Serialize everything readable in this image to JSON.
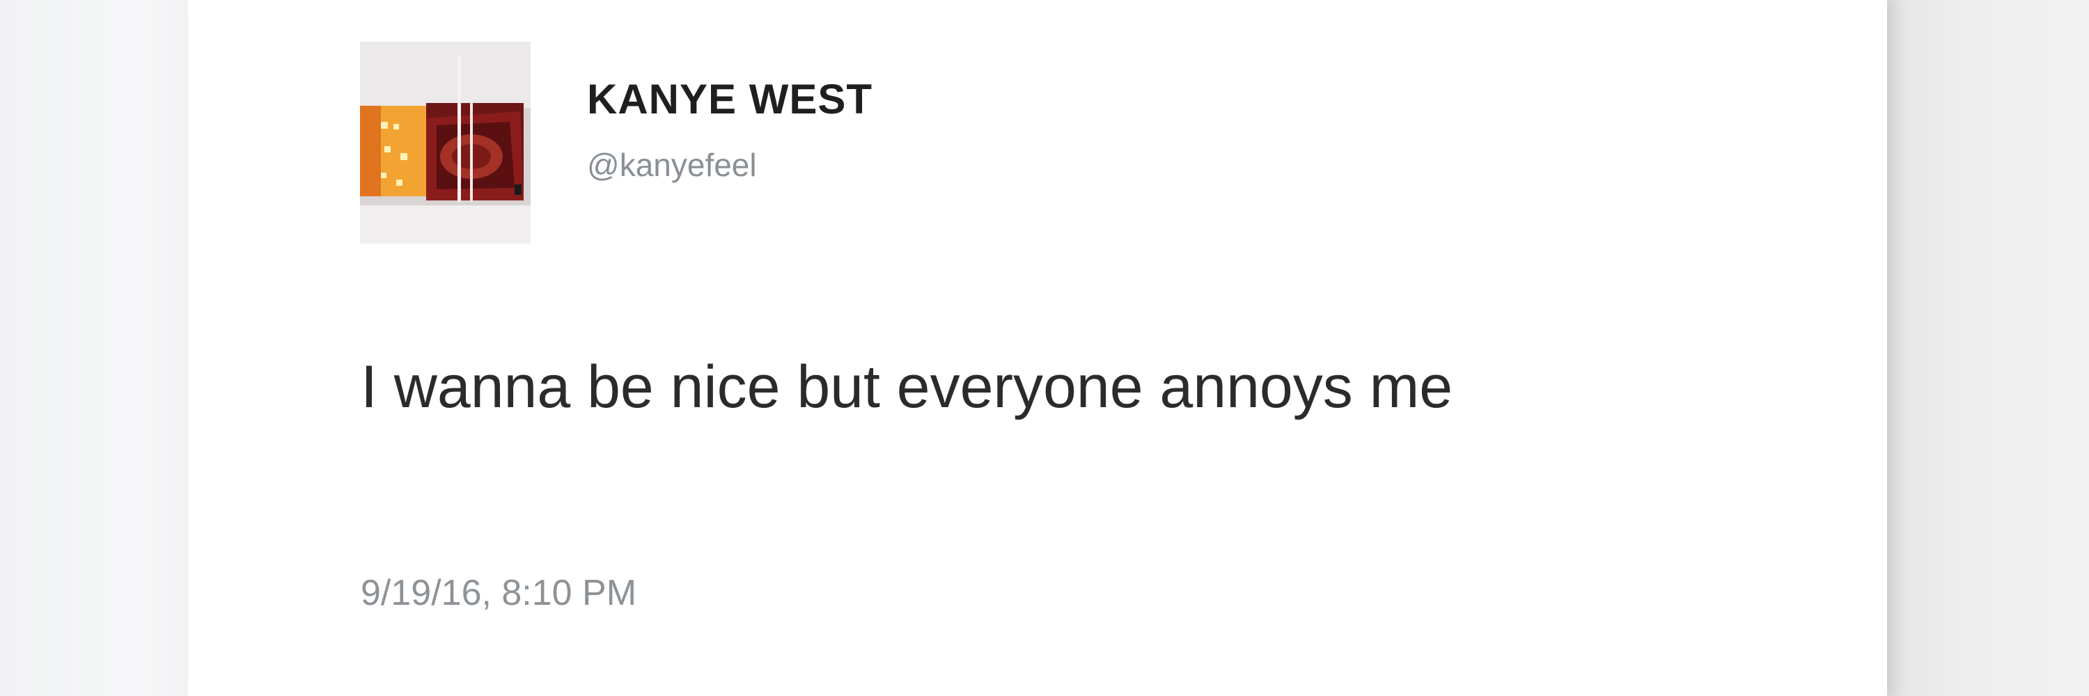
{
  "tweet": {
    "author_name": "KANYE WEST",
    "handle": "@kanyefeel",
    "text": "I wanna be nice but everyone annoys me",
    "timestamp": "9/19/16, 8:10 PM",
    "avatar_icon": "profile-photo"
  },
  "colors": {
    "card_background": "#ffffff",
    "page_background": "#f3f4f5",
    "name_text": "#1f1f1f",
    "secondary_text": "#8a8f94",
    "body_text": "#2b2b2b"
  }
}
